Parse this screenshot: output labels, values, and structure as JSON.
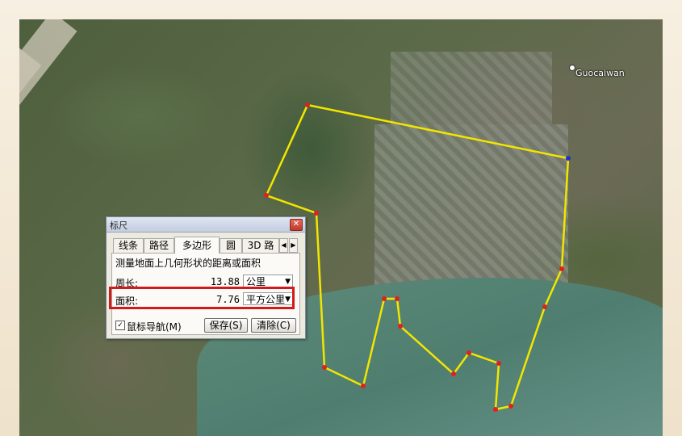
{
  "map": {
    "place_label": "Guocaiwan"
  },
  "ruler": {
    "title": "标尺",
    "close_glyph": "✕",
    "tabs": [
      {
        "label": "线条"
      },
      {
        "label": "路径"
      },
      {
        "label": "多边形"
      },
      {
        "label": "圆"
      },
      {
        "label": "3D 路"
      }
    ],
    "tab_scroll_left": "◀",
    "tab_scroll_right": "▶",
    "active_tab": "多边形",
    "description": "测量地面上几何形状的距离或面积",
    "perimeter": {
      "label": "周长:",
      "value": "13.88",
      "unit": "公里"
    },
    "area": {
      "label": "面积:",
      "value": "7.76",
      "unit": "平方公里"
    },
    "dropdown_arrow": "▼",
    "mouse_nav": {
      "label": "鼠标导航(M)",
      "checked": true,
      "check_glyph": "✓"
    },
    "save_label": "保存(S)",
    "clear_label": "清除(C)"
  },
  "colors": {
    "polygon_line": "#f2e600",
    "vertex": "#e02020",
    "highlight_box": "#d11a1a"
  }
}
